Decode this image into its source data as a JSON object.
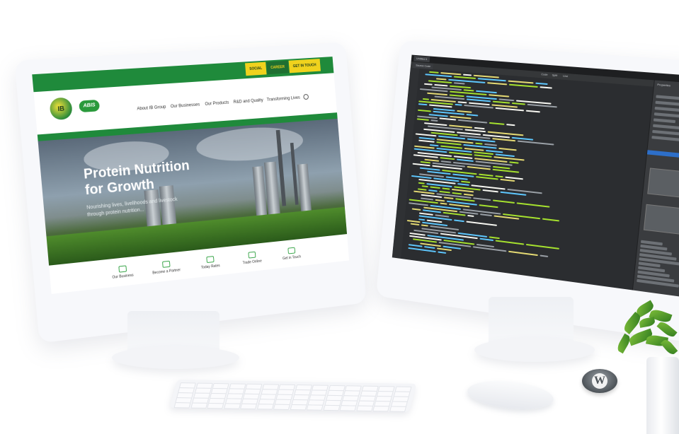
{
  "left_site": {
    "top_buttons": [
      "SOCIAL",
      "CAREER",
      "GET IN TOUCH"
    ],
    "logos": {
      "ib": "IB",
      "abis": "ABIS"
    },
    "nav": [
      "About IB Group",
      "Our Businesses",
      "Our Products",
      "R&D and Quality",
      "Transforming Lives"
    ],
    "hero": {
      "title_line1": "Protein Nutrition",
      "title_line2": "for Growth",
      "subtitle_line1": "Nourishing lives, livelihoods and livestock",
      "subtitle_line2": "through protein nutrition..."
    },
    "quick_links": [
      "Our Business",
      "Become a Partner",
      "Today Rates",
      "Trade Online",
      "Get in Touch"
    ],
    "colors": {
      "brand_green": "#1f8a3b",
      "accent_yellow": "#f0d21d"
    }
  },
  "editor": {
    "tabs": [
      "Untitled-1",
      "Source Code"
    ],
    "view_buttons": [
      "Code",
      "Split",
      "Live"
    ],
    "panel_title": "Properties",
    "colors": {
      "background": "#2b2d30",
      "tag": "#5ec8ff",
      "attr": "#a6e22e",
      "string": "#e6db74",
      "selection": "#2d6fc9"
    }
  },
  "desk": {
    "wordpress_logo": "W",
    "icons": [
      "keyboard-icon",
      "mouse-icon",
      "wordpress-icon",
      "plant-icon"
    ]
  }
}
